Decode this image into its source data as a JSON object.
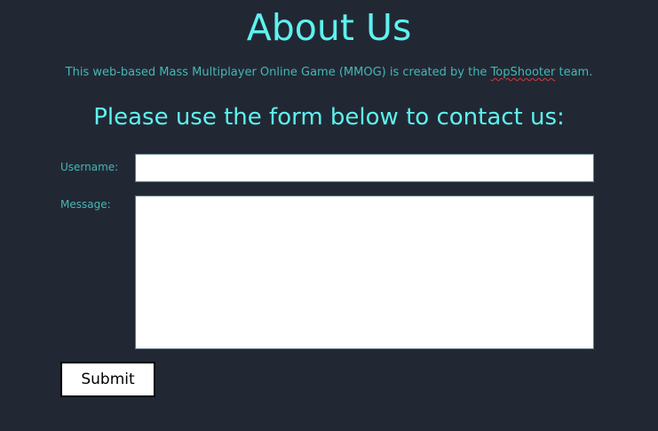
{
  "page": {
    "title": "About Us",
    "intro": {
      "before": "This web-based Mass Multiplayer Online Game (MMOG) is created by the ",
      "team_name": "TopShooter",
      "after": " team."
    },
    "subtitle": "Please use the form below to contact us:"
  },
  "form": {
    "username_label": "Username:",
    "username_value": "",
    "message_label": "Message:",
    "message_value": "",
    "submit_label": "Submit"
  },
  "colors": {
    "background": "#212834",
    "heading": "#5ef2ef",
    "text": "#46b7b4"
  }
}
